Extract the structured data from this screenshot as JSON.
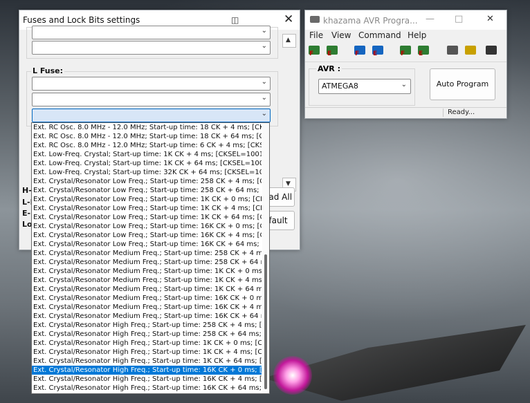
{
  "fuse_dialog": {
    "title": "Fuses and Lock Bits settings",
    "l_fuse_label": "L Fuse:",
    "side_labels": [
      "H-",
      "L-E",
      "E-F",
      "Lo"
    ],
    "read_all_label": "ead All",
    "default_label": "efault"
  },
  "dropdown": {
    "items": [
      "Ext. RC Osc. 8.0 MHz - 12.0 MHz; Start-up time: 18 CK + 4 ms; [CK",
      "Ext. RC Osc. 8.0 MHz - 12.0 MHz; Start-up time: 18 CK + 64 ms; [C",
      "Ext. RC Osc. 8.0 MHz - 12.0 MHz; Start-up time: 6 CK + 4 ms; [CKS",
      "Ext. Low-Freq. Crystal; Start-up time: 1K CK + 4 ms; [CKSEL=1001",
      "Ext. Low-Freq. Crystal; Start-up time: 1K CK + 64 ms; [CKSEL=100",
      "Ext. Low-Freq. Crystal; Start-up time: 32K CK + 64 ms; [CKSEL=10",
      "Ext. Crystal/Resonator Low Freq.; Start-up time: 258 CK + 4 ms; [C",
      "Ext. Crystal/Resonator Low Freq.; Start-up time: 258 CK + 64 ms;",
      "Ext. Crystal/Resonator Low Freq.; Start-up time: 1K CK + 0 ms; [CK",
      "Ext. Crystal/Resonator Low Freq.; Start-up time: 1K CK + 4 ms; [CK",
      "Ext. Crystal/Resonator Low Freq.; Start-up time: 1K CK + 64 ms; [C",
      "Ext. Crystal/Resonator Low Freq.; Start-up time: 16K CK + 0 ms; [C",
      "Ext. Crystal/Resonator Low Freq.; Start-up time: 16K CK + 4 ms; [C",
      "Ext. Crystal/Resonator Low Freq.; Start-up time: 16K CK + 64 ms;",
      "Ext. Crystal/Resonator Medium Freq.; Start-up time: 258 CK + 4 ms",
      "Ext. Crystal/Resonator Medium Freq.; Start-up time: 258 CK + 64 m",
      "Ext. Crystal/Resonator Medium Freq.; Start-up time: 1K CK + 0 ms;",
      "Ext. Crystal/Resonator Medium Freq.; Start-up time: 1K CK + 4 ms;",
      "Ext. Crystal/Resonator Medium Freq.; Start-up time: 1K CK + 64 ms",
      "Ext. Crystal/Resonator Medium Freq.; Start-up time: 16K CK + 0 ms",
      "Ext. Crystal/Resonator Medium Freq.; Start-up time: 16K CK + 4 ms",
      "Ext. Crystal/Resonator Medium Freq.; Start-up time: 16K CK + 64 m",
      "Ext. Crystal/Resonator High Freq.; Start-up time: 258 CK + 4 ms; [",
      "Ext. Crystal/Resonator High Freq.; Start-up time: 258 CK + 64 ms;",
      "Ext. Crystal/Resonator High Freq.; Start-up time: 1K CK + 0 ms; [C",
      "Ext. Crystal/Resonator High Freq.; Start-up time: 1K CK + 4 ms; [C",
      "Ext. Crystal/Resonator High Freq.; Start-up time: 1K CK + 64 ms; [",
      "Ext. Crystal/Resonator High Freq.; Start-up time: 16K CK + 0 ms; [",
      "Ext. Crystal/Resonator High Freq.; Start-up time: 16K CK + 4 ms; [",
      "Ext. Crystal/Resonator High Freq.; Start-up time: 16K CK + 64 ms;"
    ],
    "selected_index": 27
  },
  "khazama": {
    "title": "khazama AVR Progra...",
    "menu": [
      "File",
      "View",
      "Command",
      "Help"
    ],
    "avr_label": "AVR :",
    "avr_value": "ATMEGA8",
    "auto_program_label": "Auto Program",
    "status": "Ready...",
    "toolbar": [
      {
        "icon": "read-flash-icon",
        "letter": "F",
        "color": "#2e7d32"
      },
      {
        "icon": "write-flash-icon",
        "letter": "E",
        "color": "#2e7d32"
      },
      {
        "icon": "verify-flash-icon",
        "letter": "F",
        "color": "#1565c0"
      },
      {
        "icon": "verify-eeprom-icon",
        "letter": "E",
        "color": "#1565c0"
      },
      {
        "icon": "program-flash-icon",
        "letter": "F",
        "color": "#2e7d32"
      },
      {
        "icon": "program-eeprom-icon",
        "letter": "E",
        "color": "#2e7d32"
      },
      {
        "icon": "erase-icon",
        "letter": "",
        "color": "#555555"
      },
      {
        "icon": "lock-icon",
        "letter": "",
        "color": "#c8a000"
      },
      {
        "icon": "pin-icon",
        "letter": "",
        "color": "#333333"
      }
    ]
  }
}
